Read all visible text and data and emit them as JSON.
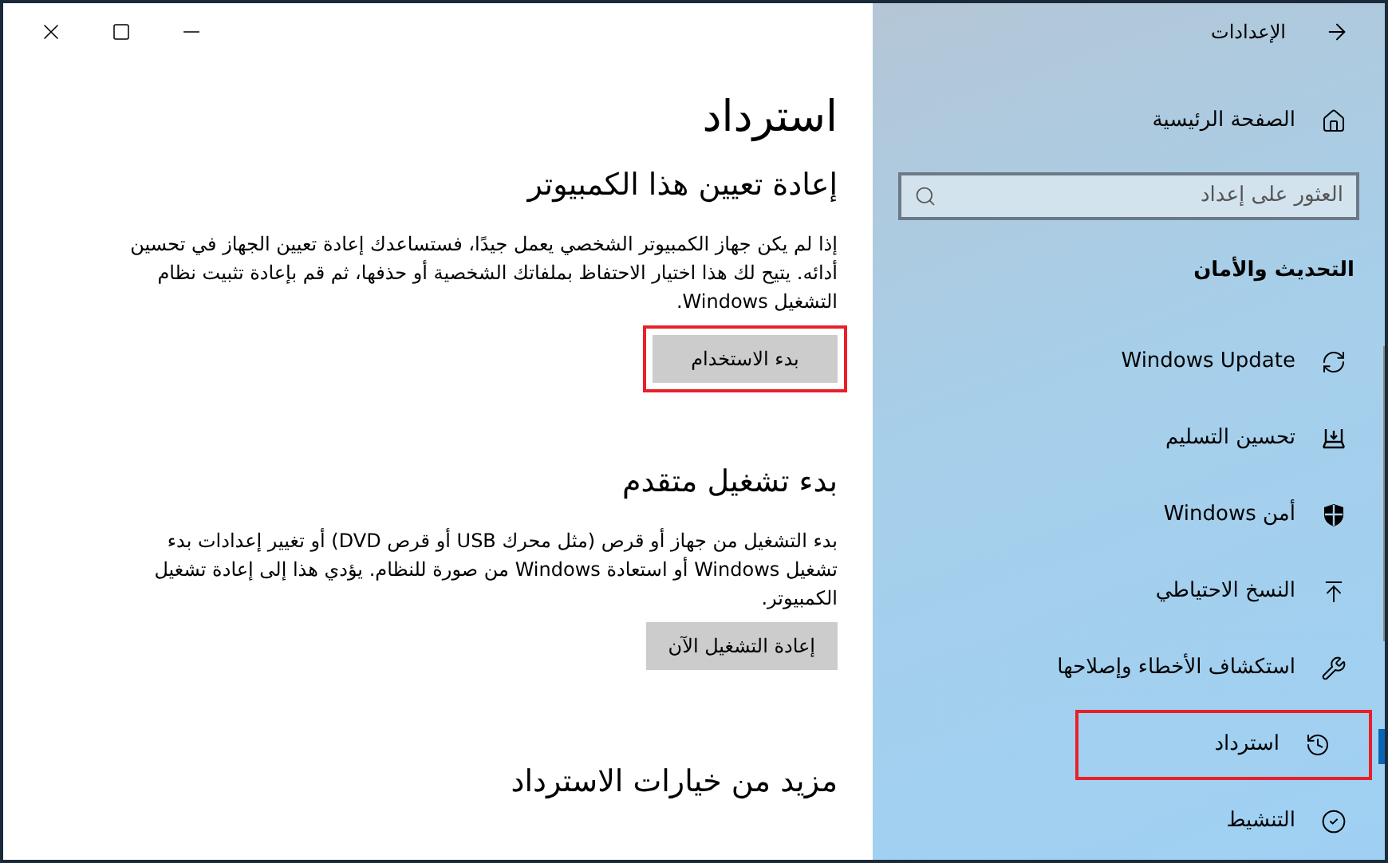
{
  "sidebar": {
    "back_label": "الإعدادات",
    "home_label": "الصفحة الرئيسية",
    "search": {
      "placeholder": "العثور على إعداد"
    },
    "section_title": "التحديث والأمان",
    "items": [
      {
        "label": "Windows Update",
        "kind": "update",
        "selected": false,
        "highlighted": false
      },
      {
        "label": "تحسين التسليم",
        "kind": "delivery",
        "selected": false,
        "highlighted": false
      },
      {
        "label": "أمن Windows",
        "kind": "security",
        "selected": false,
        "highlighted": false
      },
      {
        "label": "النسخ الاحتياطي",
        "kind": "backup",
        "selected": false,
        "highlighted": false
      },
      {
        "label": "استكشاف الأخطاء وإصلاحها",
        "kind": "troubleshoot",
        "selected": false,
        "highlighted": false
      },
      {
        "label": "استرداد",
        "kind": "recovery",
        "selected": true,
        "highlighted": true
      },
      {
        "label": "التنشيط",
        "kind": "activation",
        "selected": false,
        "highlighted": false
      }
    ]
  },
  "content": {
    "title": "استرداد",
    "sections": [
      {
        "heading": "إعادة تعيين هذا الكمبيوتر",
        "text": "إذا لم يكن جهاز الكمبيوتر الشخصي يعمل جيدًا، فستساعدك إعادة تعيين الجهاز في تحسين أدائه. يتيح لك هذا اختيار الاحتفاظ بملفاتك الشخصية أو حذفها، ثم قم بإعادة تثبيت نظام التشغيل Windows.",
        "button": {
          "label": "بدء الاستخدام",
          "highlighted": true
        }
      },
      {
        "heading": "بدء تشغيل متقدم",
        "text": "بدء التشغيل من جهاز أو قرص (مثل محرك USB أو قرص DVD) أو تغيير إعدادات بدء تشغيل Windows أو استعادة Windows من صورة للنظام. يؤدي هذا إلى إعادة تشغيل الكمبيوتر.",
        "button": {
          "label": "إعادة التشغيل الآن",
          "highlighted": false
        }
      },
      {
        "heading": "مزيد من خيارات الاسترداد"
      }
    ]
  }
}
